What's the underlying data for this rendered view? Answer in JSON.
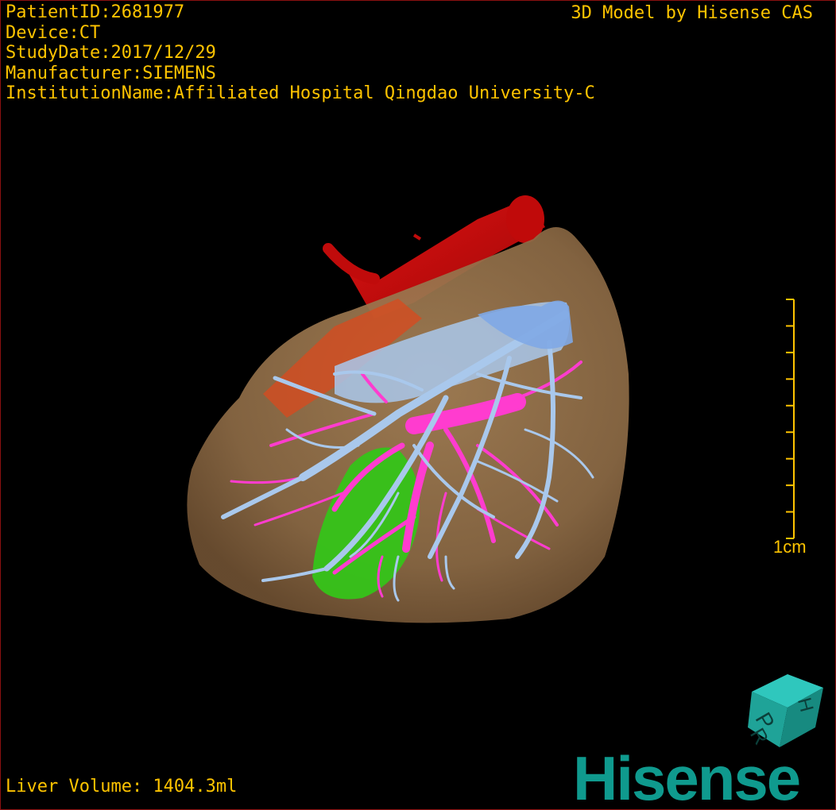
{
  "overlay": {
    "patient_id": "PatientID:2681977",
    "device": "Device:CT",
    "study_date": "StudyDate:2017/12/29",
    "manufacturer": "Manufacturer:SIEMENS",
    "institution": "InstitutionName:Affiliated Hospital Qingdao University-C",
    "credit": "3D Model by Hisense CAS",
    "liver_volume": "Liver Volume: 1404.3ml"
  },
  "scale_bar": {
    "label": "1cm",
    "ticks": 10
  },
  "orientation_cube": {
    "faces": [
      "P",
      "R",
      "H"
    ]
  },
  "brand": {
    "logo_text": "Hisense",
    "color": "#0f9a8e"
  },
  "colors": {
    "text": "#ffc400",
    "liver": "#8c6a45",
    "hepatic_artery": "#d40d0d",
    "portal_vein": "#a9c8ec",
    "hepatic_vein": "#ff3ccf",
    "lesion": "#35c419",
    "border": "#8a1010"
  }
}
